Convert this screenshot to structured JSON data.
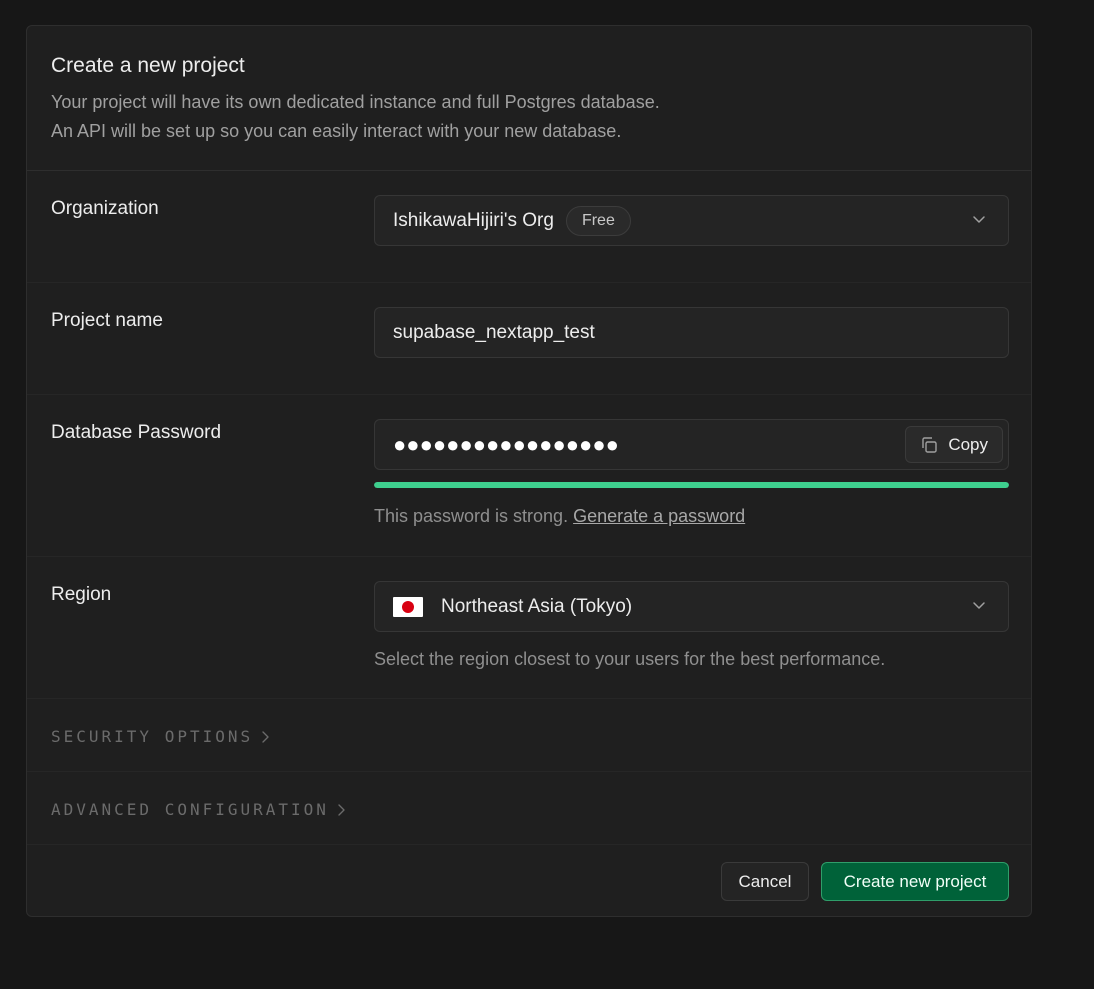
{
  "header": {
    "title": "Create a new project",
    "description_line1": "Your project will have its own dedicated instance and full Postgres database.",
    "description_line2": "An API will be set up so you can easily interact with your new database."
  },
  "organization": {
    "label": "Organization",
    "value": "IshikawaHijiri's Org",
    "plan_badge": "Free"
  },
  "project_name": {
    "label": "Project name",
    "value": "supabase_nextapp_test"
  },
  "database_password": {
    "label": "Database Password",
    "masked_value": "●●●●●●●●●●●●●●●●●",
    "copy_label": "Copy",
    "strength_fraction": 1.0,
    "strength_text": "This password is strong.",
    "generate_link": "Generate a password"
  },
  "region": {
    "label": "Region",
    "value": "Northeast Asia (Tokyo)",
    "help": "Select the region closest to your users for the best performance."
  },
  "sections": {
    "security": "SECURITY OPTIONS",
    "advanced": "ADVANCED CONFIGURATION"
  },
  "footer": {
    "cancel_label": "Cancel",
    "create_label": "Create new project"
  },
  "colors": {
    "accent": "#3ecf8e",
    "primary_button": "#006239"
  }
}
